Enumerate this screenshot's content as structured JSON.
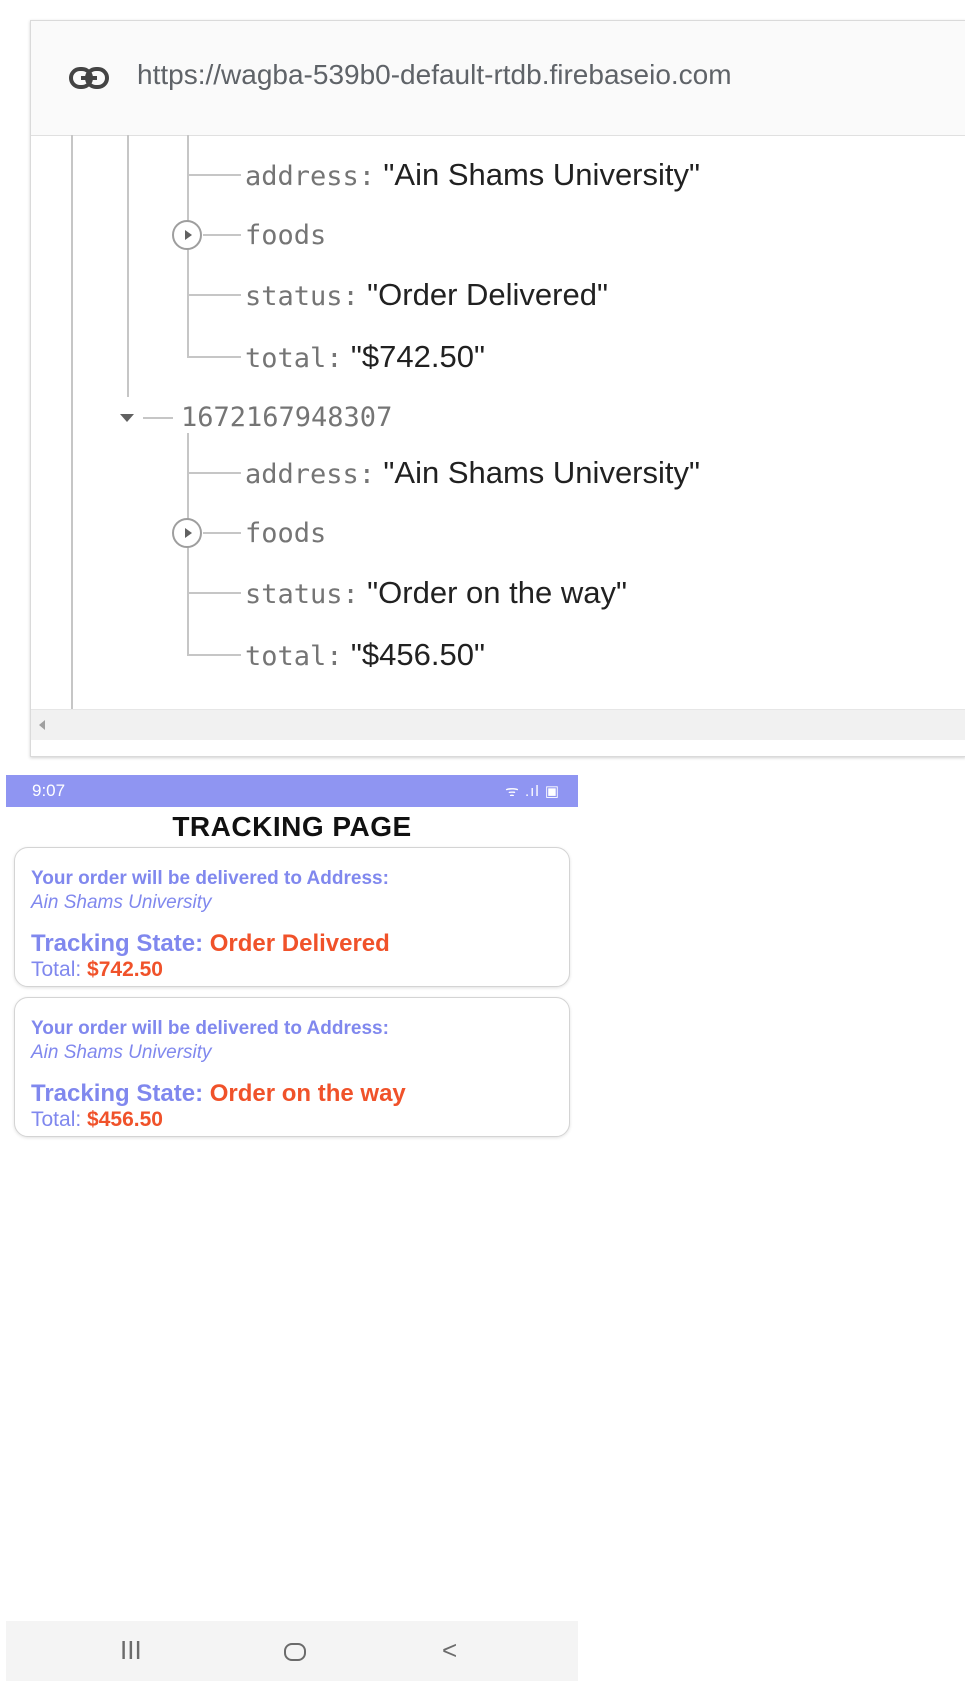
{
  "firebase": {
    "url": "https://wagba-539b0-default-rtdb.firebaseio.com",
    "orders": [
      {
        "id": "",
        "fields": [
          {
            "key": "address",
            "value": "\"Ain Shams University\""
          },
          {
            "key": "foods",
            "value": ""
          },
          {
            "key": "status",
            "value": "\"Order Delivered\""
          },
          {
            "key": "total",
            "value": "\"$742.50\""
          }
        ]
      },
      {
        "id": "1672167948307",
        "fields": [
          {
            "key": "address",
            "value": "\"Ain Shams University\""
          },
          {
            "key": "foods",
            "value": ""
          },
          {
            "key": "status",
            "value": "\"Order on the way\""
          },
          {
            "key": "total",
            "value": "\"$456.50\""
          }
        ]
      }
    ],
    "separator": ":"
  },
  "phone": {
    "status_bar": {
      "time": "9:07",
      "icons": "ᯤ .ıl ▣"
    },
    "title": "TRACKING PAGE",
    "cards": [
      {
        "address_label": "Your order will be delivered to Address:",
        "address": "Ain Shams University",
        "state_label": "Tracking State:",
        "state": "Order Delivered",
        "total_label": "Total:",
        "total": "$742.50"
      },
      {
        "address_label": "Your order will be delivered to Address:",
        "address": "Ain Shams University",
        "state_label": "Tracking State:",
        "state": "Order on the way",
        "total_label": "Total:",
        "total": "$456.50"
      }
    ],
    "nav": {
      "recents": "III",
      "back": "<"
    }
  },
  "colors": {
    "status_bar": "#8f95f2",
    "label_blue": "#8088ee",
    "value_orange": "#f0522a"
  }
}
